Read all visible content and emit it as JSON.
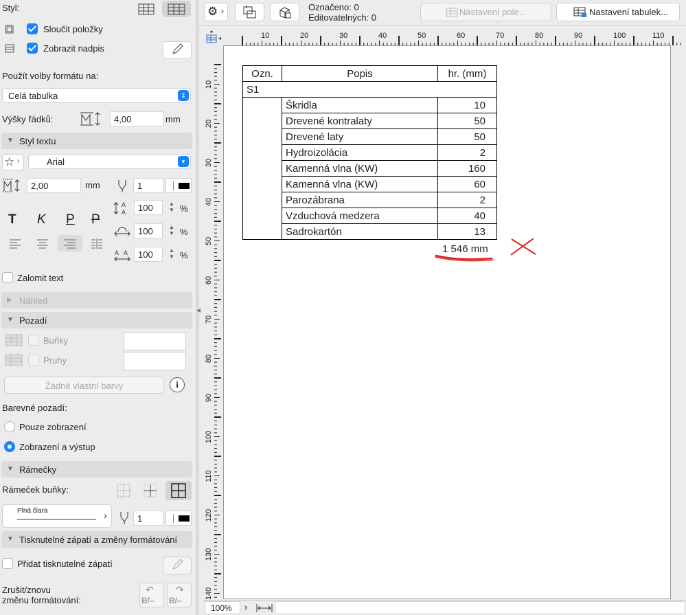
{
  "left": {
    "style_label": "Styl:",
    "merge_items_label": "Sloučit položky",
    "show_title_label": "Zobrazit nadpis",
    "apply_format_label": "Použít volby formátu na:",
    "apply_format_value": "Celá tabulka",
    "row_height_label": "Výšky řádků:",
    "row_height_value": "4,00",
    "row_height_unit": "mm",
    "text_style_section": "Styl textu",
    "font_value": "Arial",
    "font_size_value": "2,00",
    "font_size_unit": "mm",
    "pen_value": "1",
    "bold_glyph": "T",
    "italic_glyph": "K",
    "underline_glyph": "P",
    "strike_glyph": "P",
    "scale_v_value": "100",
    "scale_h_value": "100",
    "spacing_value": "100",
    "percent": "%",
    "wrap_text_label": "Zalomit text",
    "preview_section": "Náhled",
    "background_section": "Pozadí",
    "cells_label": "Buňky",
    "stripes_label": "Pruhy",
    "no_custom_colors_label": "Žádné vlastní barvy",
    "color_bg_label": "Barevné pozadí:",
    "display_only_label": "Pouze zobrazení",
    "display_output_label": "Zobrazení a výstup",
    "frames_section": "Rámečky",
    "cell_frame_label": "Rámeček buňky:",
    "line_type_value": "Plná čiara",
    "frame_pen_value": "1",
    "footer_section": "Tisknutelné zápatí a změny formátování",
    "add_footer_label": "Přidat tisknutelné zápatí",
    "undo_label_1": "Zrušit/znovu",
    "undo_label_2": "změnu formátování:",
    "undo_glyph": "B/–",
    "redo_glyph": "B/–"
  },
  "topbar": {
    "marked_label": "Označeno: 0",
    "editable_label": "Editovatelných: 0",
    "field_settings_label": "Nastavení pole...",
    "table_settings_label": "Nastavení tabulek..."
  },
  "ruler": {
    "h_ticks": [
      "10",
      "20",
      "30",
      "40",
      "50",
      "60",
      "70",
      "80",
      "90",
      "100",
      "110"
    ],
    "v_ticks": [
      "10",
      "20",
      "30",
      "40",
      "50",
      "60",
      "70",
      "80",
      "90",
      "100",
      "110",
      "120",
      "130",
      "140"
    ]
  },
  "schedule": {
    "headers": [
      "Ozn.",
      "Popis",
      "hr. (mm)"
    ],
    "group": "S1",
    "rows": [
      {
        "desc": "Škridla",
        "val": "10"
      },
      {
        "desc": "Drevené kontralaty",
        "val": "50"
      },
      {
        "desc": "Drevené laty",
        "val": "50"
      },
      {
        "desc": "Hydroizolácia",
        "val": "2"
      },
      {
        "desc": "Kamenná vlna (KW)",
        "val": "160"
      },
      {
        "desc": "Kamenná vlna (KW)",
        "val": "60"
      },
      {
        "desc": "Parozábrana",
        "val": "2"
      },
      {
        "desc": "Vzduchová medzera",
        "val": "40"
      },
      {
        "desc": "Sadrokartón",
        "val": "13"
      }
    ],
    "total": "1 546 mm"
  },
  "bottombar": {
    "zoom": "100%"
  },
  "colors": {
    "accent": "#1a82fb",
    "annotation_red": "#e0211b"
  }
}
